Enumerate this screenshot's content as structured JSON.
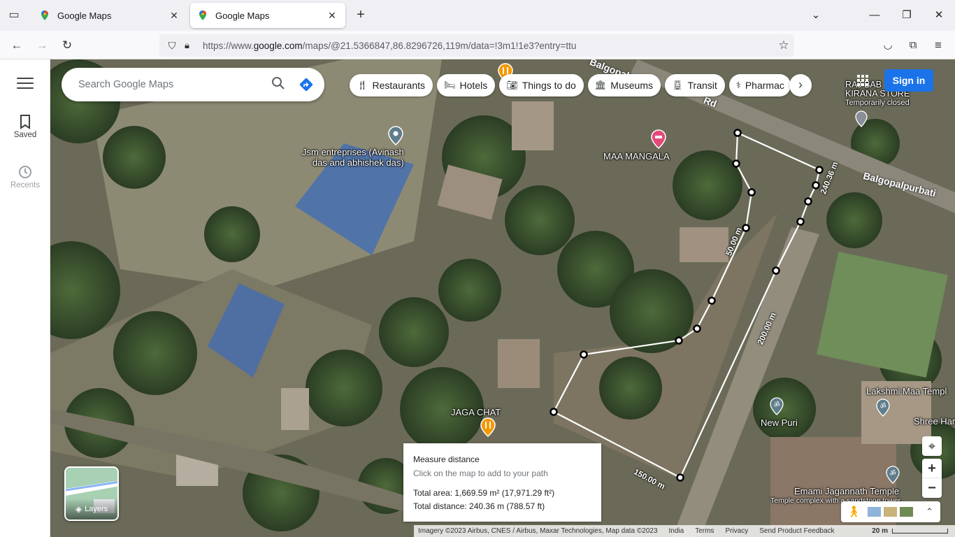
{
  "browser": {
    "tabs": [
      {
        "title": "Google Maps",
        "active": false
      },
      {
        "title": "Google Maps",
        "active": true
      }
    ],
    "url_prefix": "https://www.",
    "url_domain": "google.com",
    "url_rest": "/maps/@21.5366847,86.8296726,119m/data=!3m1!1e3?entry=ttu"
  },
  "rail": {
    "items": [
      {
        "label": "Saved"
      },
      {
        "label": "Recents"
      }
    ]
  },
  "search": {
    "placeholder": "Search Google Maps"
  },
  "chips": [
    {
      "label": "Restaurants",
      "icon": "restaurant-icon"
    },
    {
      "label": "Hotels",
      "icon": "hotel-icon"
    },
    {
      "label": "Things to do",
      "icon": "camera-icon"
    },
    {
      "label": "Museums",
      "icon": "museum-icon"
    },
    {
      "label": "Transit",
      "icon": "transit-icon"
    },
    {
      "label": "Pharmac",
      "icon": "pharmacy-icon"
    }
  ],
  "account": {
    "signin_label": "Sign in"
  },
  "places": {
    "jsm_line1": "Jsm entreprises (Avinash",
    "jsm_line2": "das and abhishek das)",
    "maa_mangala": "MAA MANGALA",
    "store_line1": "RAJ BAB",
    "store_line2": "KIRANA STORE",
    "store_status": "Temporarily closed",
    "road": "Balgopalpurbati",
    "road_top": "Balgopalpur",
    "road_top_suffix": "Rd",
    "jaga_chat": "JAGA CHAT",
    "new_puri": "New Puri",
    "lakshmi": "Lakshmi Maa Templ",
    "shree": "Shree Har",
    "emami": "Emami Jagannath Temple",
    "emami_desc": "Temple complex with a sandstone tower"
  },
  "measurement_labels": [
    "240.36 m",
    "50.00 m",
    "200.00 m",
    "150.00 m"
  ],
  "measure_panel": {
    "title": "Measure distance",
    "hint": "Click on the map to add to your path",
    "area": "Total area: 1,669.59 m² (17,971.29 ft²)",
    "distance": "Total distance: 240.36 m (788.57 ft)"
  },
  "layers": {
    "label": "Layers"
  },
  "footer": {
    "imagery": "Imagery ©2023 Airbus, CNES / Airbus, Maxar Technologies, Map data ©2023",
    "country": "India",
    "terms": "Terms",
    "privacy": "Privacy",
    "feedback": "Send Product Feedback",
    "scale": "20 m"
  },
  "colors": {
    "accent": "#1a73e8",
    "measure_line": "#ffffff"
  }
}
